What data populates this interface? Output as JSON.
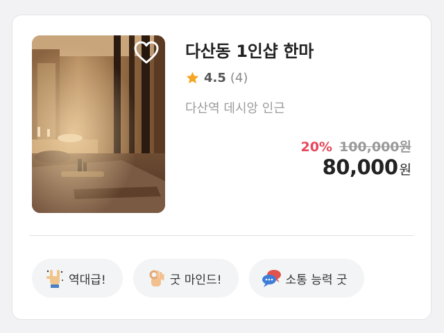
{
  "listing": {
    "title": "다산동 1인샵 한마",
    "rating": "4.5",
    "review_count": "(4)",
    "location": "다산역 데시앙 인근",
    "discount_rate": "20%",
    "original_price": "100,000원",
    "price": "80,000",
    "currency": "원",
    "image_alt": "spa-room-photo",
    "favorite_icon": "heart-outline-icon",
    "rating_icon": "star-icon"
  },
  "tags": [
    {
      "label": "역대급!",
      "icon": "rock-hand-emoji-icon"
    },
    {
      "label": "굿 마인드!",
      "icon": "ok-hand-emoji-icon"
    },
    {
      "label": "소통 능력 굿",
      "icon": "speech-bubbles-emoji-icon"
    }
  ],
  "colors": {
    "discount": "#e8475b",
    "star": "#f5a623",
    "title": "#222222",
    "muted": "#9a9a9a"
  }
}
